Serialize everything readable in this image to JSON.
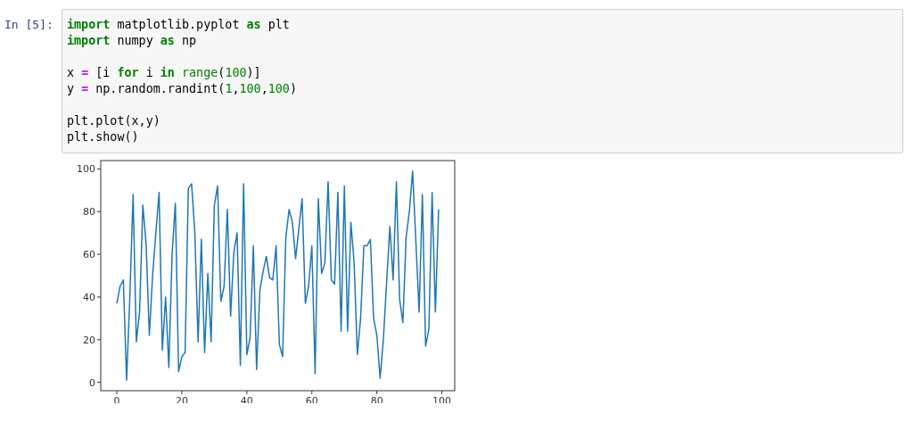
{
  "cell": {
    "prompt": "In [5]:",
    "code_blocks": [
      [
        [
          {
            "kind": "kw",
            "text": "import"
          },
          {
            "kind": "plain",
            "text": " matplotlib.pyplot "
          },
          {
            "kind": "kw",
            "text": "as"
          },
          {
            "kind": "plain",
            "text": " plt"
          }
        ],
        [
          {
            "kind": "kw",
            "text": "import"
          },
          {
            "kind": "plain",
            "text": " numpy "
          },
          {
            "kind": "kw",
            "text": "as"
          },
          {
            "kind": "plain",
            "text": " np"
          }
        ]
      ],
      [
        [
          {
            "kind": "plain",
            "text": "x "
          },
          {
            "kind": "op",
            "text": "="
          },
          {
            "kind": "plain",
            "text": " [i "
          },
          {
            "kind": "kw",
            "text": "for"
          },
          {
            "kind": "plain",
            "text": " i "
          },
          {
            "kind": "kw",
            "text": "in"
          },
          {
            "kind": "builtin",
            "text": " range"
          },
          {
            "kind": "plain",
            "text": "("
          },
          {
            "kind": "num",
            "text": "100"
          },
          {
            "kind": "plain",
            "text": ")]"
          }
        ],
        [
          {
            "kind": "plain",
            "text": "y "
          },
          {
            "kind": "op",
            "text": "="
          },
          {
            "kind": "plain",
            "text": " np.random.randint("
          },
          {
            "kind": "num",
            "text": "1"
          },
          {
            "kind": "plain",
            "text": ","
          },
          {
            "kind": "num",
            "text": "100"
          },
          {
            "kind": "plain",
            "text": ","
          },
          {
            "kind": "num",
            "text": "100"
          },
          {
            "kind": "plain",
            "text": ")"
          }
        ]
      ],
      [
        [
          {
            "kind": "plain",
            "text": "plt.plot(x,y)"
          }
        ],
        [
          {
            "kind": "plain",
            "text": "plt.show()"
          }
        ]
      ]
    ]
  },
  "output": {
    "chart_data": {
      "type": "line",
      "xlim": [
        -4.95,
        103.95
      ],
      "ylim": [
        -3.9,
        103.9
      ],
      "xticks": [
        0,
        20,
        40,
        60,
        80,
        100
      ],
      "yticks": [
        0,
        20,
        40,
        60,
        80,
        100
      ],
      "x": [
        0,
        1,
        2,
        3,
        4,
        5,
        6,
        7,
        8,
        9,
        10,
        11,
        12,
        13,
        14,
        15,
        16,
        17,
        18,
        19,
        20,
        21,
        22,
        23,
        24,
        25,
        26,
        27,
        28,
        29,
        30,
        31,
        32,
        33,
        34,
        35,
        36,
        37,
        38,
        39,
        40,
        41,
        42,
        43,
        44,
        45,
        46,
        47,
        48,
        49,
        50,
        51,
        52,
        53,
        54,
        55,
        56,
        57,
        58,
        59,
        60,
        61,
        62,
        63,
        64,
        65,
        66,
        67,
        68,
        69,
        70,
        71,
        72,
        73,
        74,
        75,
        76,
        77,
        78,
        79,
        80,
        81,
        82,
        83,
        84,
        85,
        86,
        87,
        88,
        89,
        90,
        91,
        92,
        93,
        94,
        95,
        96,
        97,
        98,
        99
      ],
      "series": [
        {
          "color": "#1f77b4",
          "values": [
            37,
            45,
            48,
            1,
            40,
            88,
            19,
            33,
            83,
            65,
            22,
            50,
            70,
            89,
            15,
            40,
            7,
            60,
            84,
            5,
            12,
            14,
            91,
            93,
            70,
            19,
            67,
            14,
            51,
            19,
            83,
            92,
            38,
            45,
            81,
            31,
            61,
            70,
            8,
            93,
            13,
            21,
            64,
            6,
            43,
            52,
            59,
            49,
            48,
            64,
            18,
            12,
            68,
            81,
            75,
            58,
            72,
            86,
            37,
            45,
            64,
            4,
            86,
            51,
            56,
            94,
            48,
            46,
            89,
            24,
            92,
            24,
            75,
            56,
            13,
            30,
            64,
            64,
            67,
            30,
            22,
            2,
            20,
            47,
            73,
            48,
            94,
            39,
            28,
            68,
            80,
            99,
            66,
            33,
            88,
            17,
            25,
            89,
            33,
            81
          ]
        }
      ]
    }
  }
}
